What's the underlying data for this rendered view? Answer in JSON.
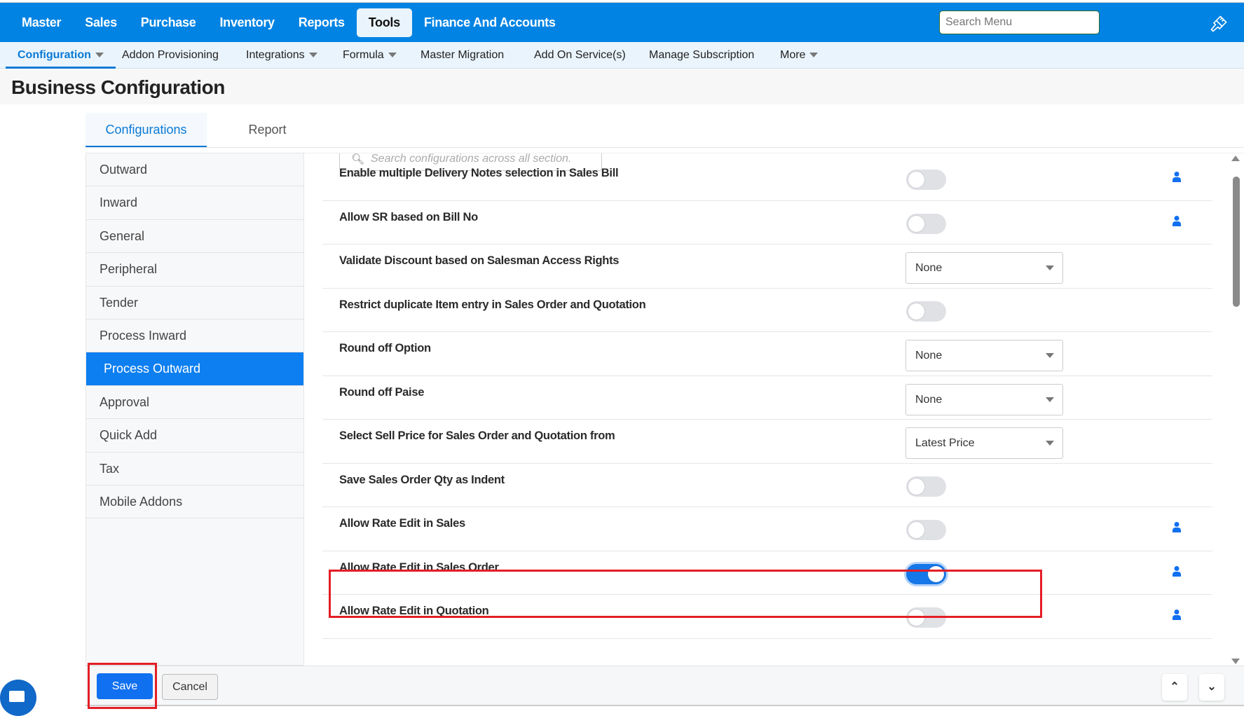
{
  "topnav": {
    "items": [
      "Master",
      "Sales",
      "Purchase",
      "Inventory",
      "Reports",
      "Tools",
      "Finance And Accounts"
    ],
    "active": "Tools",
    "search_placeholder": "Search Menu"
  },
  "subnav": {
    "items": [
      "Configuration",
      "Addon Provisioning",
      "Integrations",
      "Formula",
      "Master Migration",
      "Add On Service(s)",
      "Manage Subscription",
      "More"
    ]
  },
  "page_title": "Business Configuration",
  "tabs": [
    "Configurations",
    "Report"
  ],
  "sidebar": [
    "Outward",
    "Inward",
    "General",
    "Peripheral",
    "Tender",
    "Process Inward",
    "Process Outward",
    "Approval",
    "Quick Add",
    "Tax",
    "Mobile Addons"
  ],
  "content_search_placeholder": "Search configurations across all section.",
  "rows": [
    {
      "label": "Enable multiple Delivery Notes selection in Sales Bill",
      "type": "toggle",
      "on": false,
      "user": true
    },
    {
      "label": "Allow SR based on Bill No",
      "type": "toggle",
      "on": false,
      "user": true
    },
    {
      "label": "Validate Discount based on Salesman Access Rights",
      "type": "select",
      "value": "None"
    },
    {
      "label": "Restrict duplicate Item entry in Sales Order and Quotation",
      "type": "toggle",
      "on": false
    },
    {
      "label": "Round off Option",
      "type": "select",
      "value": "None"
    },
    {
      "label": "Round off Paise",
      "type": "select",
      "value": "None"
    },
    {
      "label": "Select Sell Price for Sales Order and Quotation from",
      "type": "select",
      "value": "Latest Price"
    },
    {
      "label": "Save Sales Order Qty as Indent",
      "type": "toggle",
      "on": false
    },
    {
      "label": "Allow Rate Edit in Sales",
      "type": "toggle",
      "on": false,
      "user": true
    },
    {
      "label": "Allow Rate Edit in Sales Order",
      "type": "toggle",
      "on": true,
      "user": true
    },
    {
      "label": "Allow Rate Edit in Quotation",
      "type": "toggle",
      "on": false,
      "user": true
    }
  ],
  "footer": {
    "save": "Save",
    "cancel": "Cancel",
    "up": "⌃",
    "down": "⌄"
  },
  "colors": {
    "brand": "#0083e3",
    "accent": "#1170f0",
    "highlight": "#e41e26"
  }
}
